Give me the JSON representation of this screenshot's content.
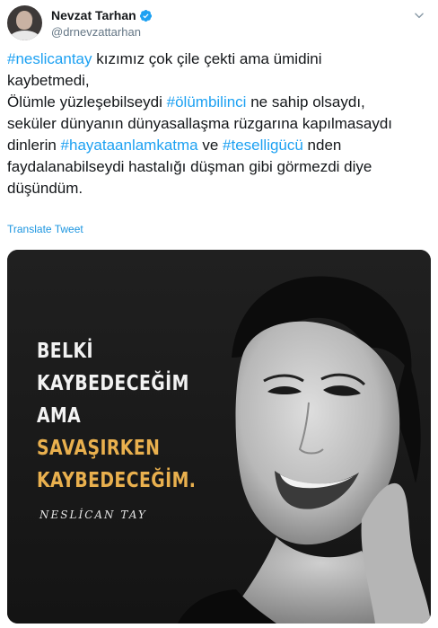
{
  "author": {
    "display_name": "Nevzat Tarhan",
    "handle": "@drnevzattarhan",
    "verified": true
  },
  "tweet": {
    "line1": {
      "tag": "#neslicantay",
      "text": " kızımız çok çile çekti ama ümidini"
    },
    "line2": "kaybetmedi,",
    "line3": {
      "before": "Ölümle yüzleşebilseydi ",
      "tag": "#ölümbilinci",
      "after": " ne sahip olsaydı,"
    },
    "line4": "seküler dünyanın dünyasallaşma rüzgarına kapılmasaydı",
    "line5": {
      "before": "dinlerin ",
      "tag1": "#hayataanlamkatma",
      "middle": " ve ",
      "tag2": "#teselligücü",
      "after": " nden"
    },
    "line6": "faydalanabilseydi hastalığı düşman gibi görmezdi diye",
    "line7": "düşündüm.",
    "translate_label": "Translate Tweet"
  },
  "media": {
    "quote_lines": [
      "BELKİ",
      "KAYBEDECEĞİM",
      "AMA",
      "SAVAŞIRKEN",
      "KAYBEDECEĞİM."
    ],
    "signature": "NESLİCAN TAY",
    "accent_color": "#e9b04e"
  },
  "icons": {
    "verified": "verified-badge-icon",
    "more": "chevron-down-icon"
  },
  "colors": {
    "link": "#1da1f2",
    "handle": "#657786",
    "text": "#14171a"
  }
}
